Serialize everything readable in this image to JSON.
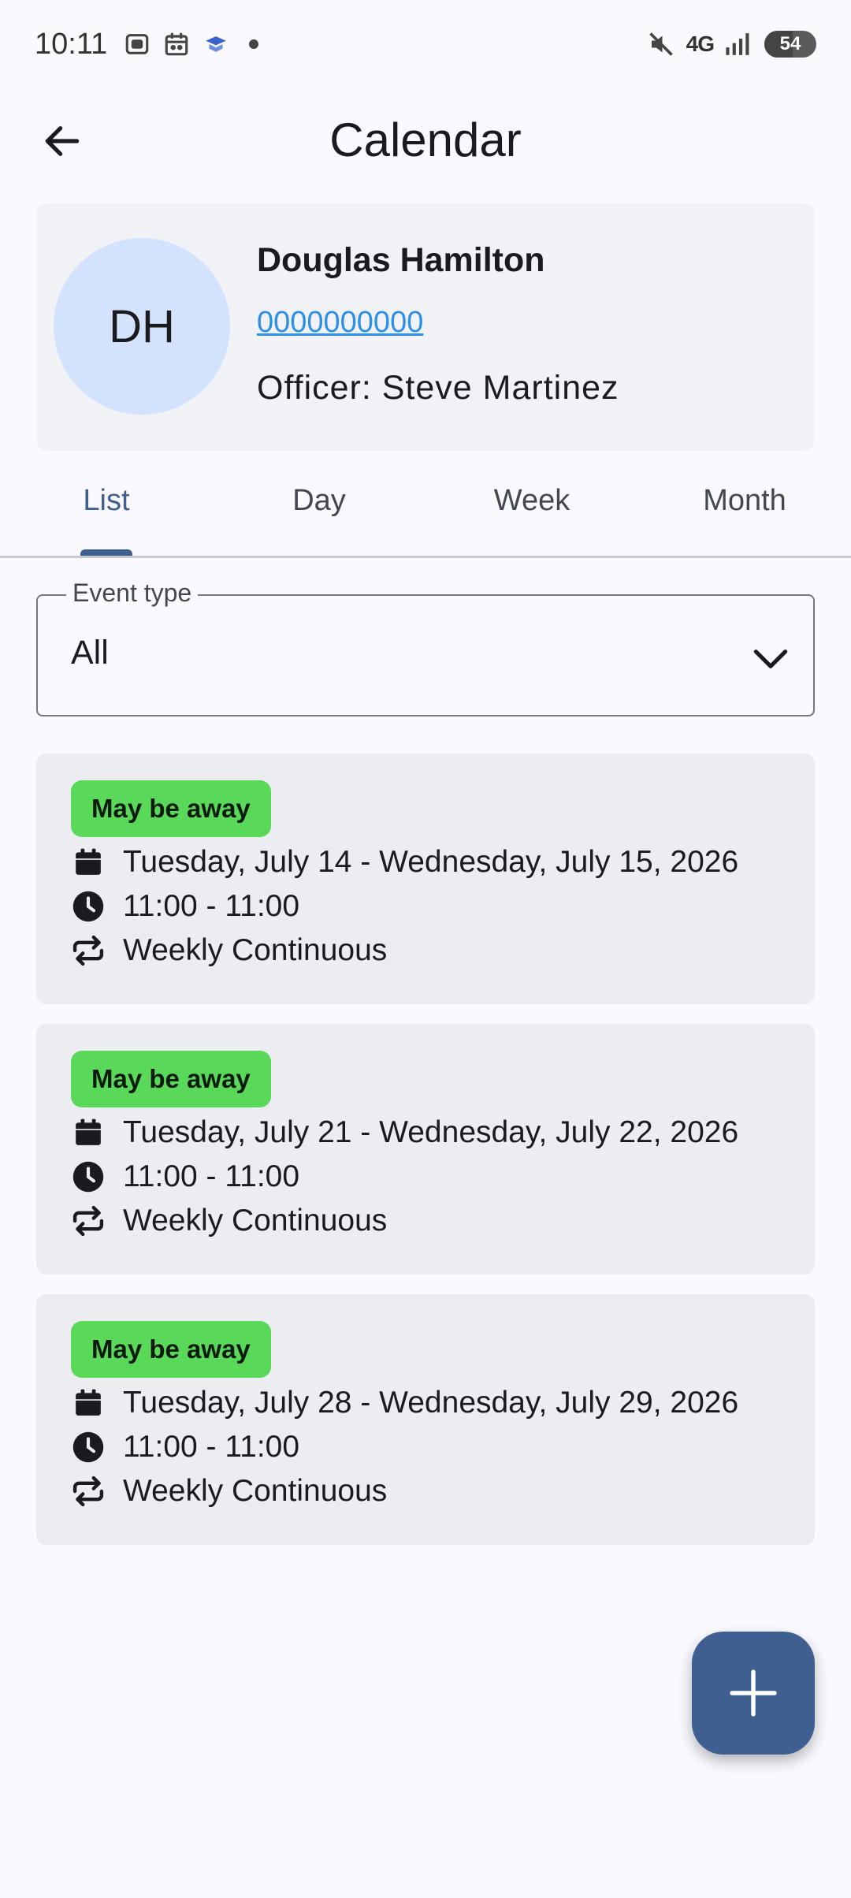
{
  "status_bar": {
    "time": "10:11",
    "network": "4G",
    "battery": "54",
    "battery_level": 0.54
  },
  "app_bar": {
    "title": "Calendar",
    "back_icon": "arrow-left-icon"
  },
  "profile": {
    "initials": "DH",
    "name": "Douglas Hamilton",
    "phone": "0000000000",
    "officer": "Officer: Steve Martinez"
  },
  "tabs": [
    {
      "label": "List",
      "active": true
    },
    {
      "label": "Day",
      "active": false
    },
    {
      "label": "Week",
      "active": false
    },
    {
      "label": "Month",
      "active": false
    }
  ],
  "filter": {
    "label": "Event type",
    "value": "All"
  },
  "events": [
    {
      "badge": "May be away",
      "date_range": "Tuesday, July 14 - Wednesday, July 15, 2026",
      "time_range": "11:00 - 11:00",
      "recurrence": "Weekly Continuous"
    },
    {
      "badge": "May be away",
      "date_range": "Tuesday, July 21 - Wednesday, July 22, 2026",
      "time_range": "11:00 - 11:00",
      "recurrence": "Weekly Continuous"
    },
    {
      "badge": "May be away",
      "date_range": "Tuesday, July 28 - Wednesday, July 29, 2026",
      "time_range": "11:00 - 11:00",
      "recurrence": "Weekly Continuous"
    }
  ],
  "fab": {
    "icon": "plus-icon"
  },
  "colors": {
    "accent": "#3e5f8f",
    "badge": "#5ad85a",
    "link": "#2d8fe6",
    "avatar_bg": "#d4e3fd"
  }
}
